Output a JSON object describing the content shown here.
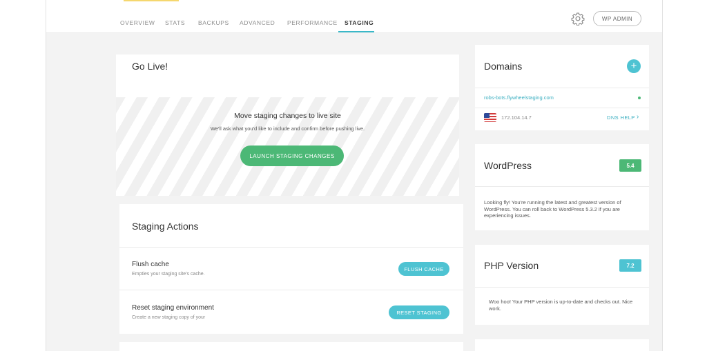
{
  "nav": {
    "tabs": [
      "OVERVIEW",
      "STATS",
      "BACKUPS",
      "ADVANCED",
      "PERFORMANCE",
      "STAGING"
    ],
    "active_tab": "STAGING",
    "wp_admin_label": "WP ADMIN"
  },
  "go_live": {
    "title": "Go Live!",
    "heading": "Move staging changes to live site",
    "description": "We'll ask what you'd like to include and confirm before pushing live.",
    "button_label": "LAUNCH STAGING CHANGES"
  },
  "staging_actions": {
    "title": "Staging Actions",
    "actions": [
      {
        "title": "Flush cache",
        "description": "Empties your staging site's cache.",
        "button_label": "FLUSH CACHE"
      },
      {
        "title": "Reset staging environment",
        "description": "Create a new staging copy of your",
        "button_label": "RESET STAGING"
      }
    ]
  },
  "domains": {
    "title": "Domains",
    "domain": "robs-bots.flywheelstaging.com",
    "ip": "172.104.14.7",
    "dns_help_label": "DNS HELP"
  },
  "wordpress": {
    "title": "WordPress",
    "version": "5.4",
    "text": "Looking fly! You're running the latest and greatest version of WordPress. You can roll back to WordPress 5.3.2 if you are experiencing issues."
  },
  "php": {
    "title": "PHP Version",
    "version": "7.2",
    "text": "Woo hoo! Your PHP version is up-to-date and checks out. Nice work."
  },
  "colors": {
    "accent_teal": "#4ec3d2",
    "launch_green": "#4cb876",
    "wordpress_badge": "#4cb876",
    "php_badge": "#4ec3d2"
  }
}
